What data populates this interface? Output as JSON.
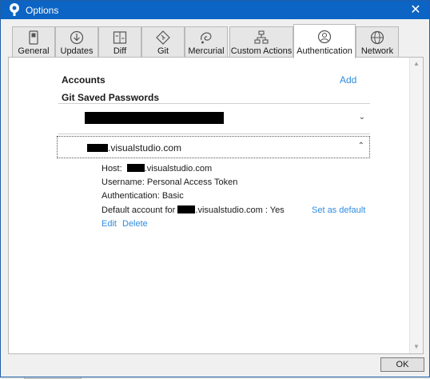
{
  "window": {
    "title": "Options",
    "close_glyph": "✕"
  },
  "tabs": [
    {
      "label": "General",
      "icon": "settings-device-icon"
    },
    {
      "label": "Updates",
      "icon": "download-circle-icon"
    },
    {
      "label": "Diff",
      "icon": "diff-icon"
    },
    {
      "label": "Git",
      "icon": "git-diamond-icon"
    },
    {
      "label": "Mercurial",
      "icon": "mercurial-icon"
    },
    {
      "label": "Custom Actions",
      "icon": "custom-actions-icon"
    },
    {
      "label": "Authentication",
      "icon": "user-circle-icon",
      "active": true
    },
    {
      "label": "Network",
      "icon": "globe-icon"
    }
  ],
  "accounts": {
    "heading": "Accounts",
    "add_label": "Add",
    "saved_heading": "Git Saved Passwords",
    "entry": {
      "account_suffix": ".visualstudio.com",
      "host_label": "Host:",
      "host_suffix": ".visualstudio.com",
      "username_label": "Username:",
      "username_value": "Personal Access Token",
      "auth_label": "Authentication:",
      "auth_value": "Basic",
      "default_label": "Default account for",
      "default_suffix": ".visualstudio.com :",
      "default_value": "Yes",
      "set_default_label": "Set as default",
      "edit_label": "Edit",
      "delete_label": "Delete"
    }
  },
  "ok_label": "OK",
  "colors": {
    "titlebar": "#0c64c4",
    "link": "#2f8ce0"
  }
}
